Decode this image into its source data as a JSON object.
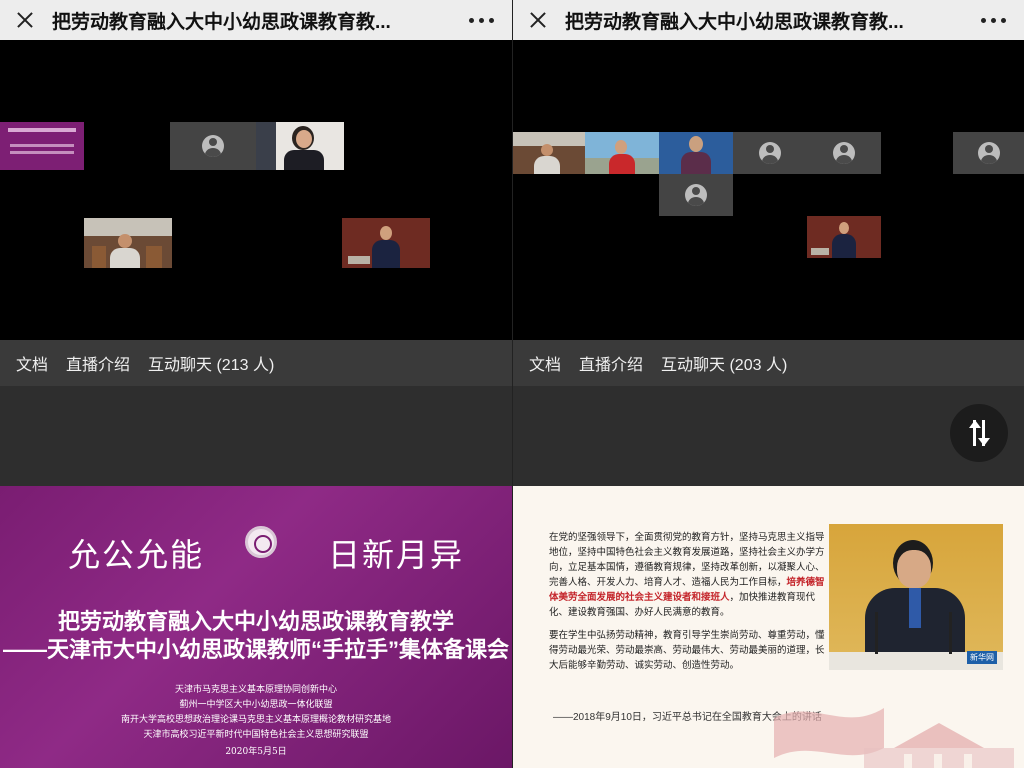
{
  "left": {
    "title": "把劳动教育融入大中小幼思政课教育教...",
    "tabs": [
      {
        "label": "文档",
        "active": true
      },
      {
        "label": "直播介绍",
        "active": false
      },
      {
        "label": "互动聊天 (213 人)",
        "active": false
      }
    ],
    "slide": {
      "motto_left": "允公允能",
      "motto_right": "日新月异",
      "title_line1": "把劳动教育融入大中小幼思政课教育教学",
      "title_line2": "——天津市大中小幼思政课教师“手拉手”集体备课会",
      "orgs": [
        "天津市马克思主义基本原理协同创新中心",
        "蓟州一中学区大中小幼思政一体化联盟",
        "南开大学高校思想政治理论课马克思主义基本原理概论教材研究基地",
        "天津市高校习近平新时代中国特色社会主义思想研究联盟"
      ],
      "date": "2020年5月5日"
    }
  },
  "right": {
    "title": "把劳动教育融入大中小幼思政课教育教...",
    "tabs": [
      {
        "label": "文档",
        "active": true
      },
      {
        "label": "直播介绍",
        "active": false
      },
      {
        "label": "互动聊天 (203 人)",
        "active": false
      }
    ],
    "slide": {
      "para1_before": "在党的坚强领导下，全面贯彻党的教育方针，坚持马克思主义指导地位，坚持中国特色社会主义教育发展道路，坚持社会主义办学方向，立足基本国情，遵循教育规律，坚持改革创新，以凝聚人心、完善人格、开发人力、培育人才、造福人民为工作目标，",
      "para1_highlight": "培养德智体美劳全面发展的社会主义建设者和接班人",
      "para1_after": "，加快推进教育现代化、建设教育强国、办好人民满意的教育。",
      "para2": "要在学生中弘扬劳动精神，教育引导学生崇尚劳动、尊重劳动，懂得劳动最光荣、劳动最崇高、劳动最伟大、劳动最美丽的道理，长大后能够辛勤劳动、诚实劳动、创造性劳动。",
      "caption": "——2018年9月10日，习近平总书记在全国教育大会上的讲话",
      "watermark": "新华网"
    }
  },
  "colors": {
    "titlebar": "#ededed",
    "tabbar": "#3a3a3a",
    "slide_purple": "#7a1d72",
    "highlight_red": "#c4252b",
    "photo_gold": "#d7a53b"
  }
}
